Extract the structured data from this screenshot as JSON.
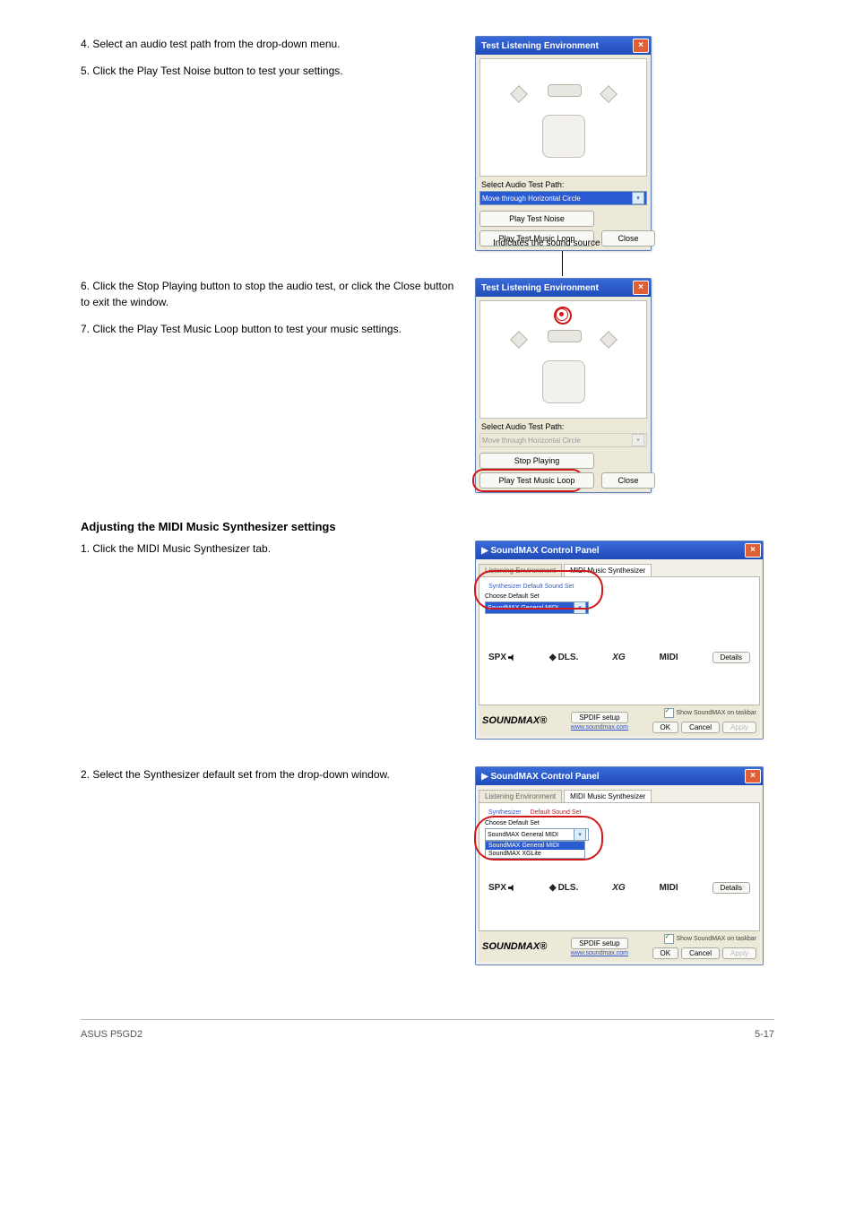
{
  "section1": {
    "para1": "4. Select an audio test path from the drop-down menu.",
    "para2": "5. Click the Play Test Noise button to test your settings."
  },
  "dialog1": {
    "title": "Test Listening Environment",
    "select_label": "Select Audio Test Path:",
    "dropdown_value": "Move through Horizontal Circle",
    "play_noise": "Play Test Noise",
    "play_music": "Play Test Music Loop",
    "close": "Close"
  },
  "section2": {
    "annotation": "Indicates the sound source",
    "para1": "6. Click the Stop Playing button to stop the audio test, or click the Close button to exit the window.",
    "para2": "7. Click the Play Test Music Loop button to test your music settings.",
    "dialog_title": "Test Listening Environment",
    "select_label": "Select Audio Test Path:",
    "dropdown_value": "Move through Horizontal Circle",
    "stop": "Stop Playing",
    "play_music": "Play Test Music Loop",
    "close": "Close"
  },
  "section3": {
    "heading": "Adjusting the MIDI Music Synthesizer settings",
    "para": "1. Click the MIDI Music Synthesizer tab."
  },
  "cp1": {
    "title": "SoundMAX Control Panel",
    "tab1": "Listening Environment",
    "tab2": "MIDI Music Synthesizer",
    "minitab1": "Synthesizer Default Sound Set",
    "choose_label": "Choose Default Set",
    "dropdown_value": "SoundMAX General MIDI",
    "details": "Details",
    "spdif": "SPDIF setup",
    "url": "www.soundmax.com",
    "checkbox": "Show SoundMAX on taskbar",
    "ok": "OK",
    "cancel": "Cancel",
    "apply": "Apply",
    "soundmax": "SOUNDMAX®"
  },
  "section4": {
    "para": "2. Select the Synthesizer default set from the drop-down window."
  },
  "cp2": {
    "title": "SoundMAX Control Panel",
    "tab1": "Listening Environment",
    "tab2": "MIDI Music Synthesizer",
    "minitab1": "Synthesizer",
    "minitab2": "Default Sound Set",
    "choose_label": "Choose Default Set",
    "selected": "SoundMAX General MIDI",
    "option2": "SoundMAX General MIDI",
    "option3": "SoundMAX XGLite",
    "details": "Details",
    "spdif": "SPDIF setup",
    "url": "www.soundmax.com",
    "checkbox": "Show SoundMAX on taskbar",
    "ok": "OK",
    "cancel": "Cancel",
    "apply": "Apply",
    "soundmax": "SOUNDMAX®"
  },
  "cp_logos": {
    "spx": "SPX",
    "dls": "DLS.",
    "xg": "XG",
    "midi": "MIDI"
  },
  "footer": {
    "left": "ASUS P5GD2",
    "right": "5-17"
  }
}
